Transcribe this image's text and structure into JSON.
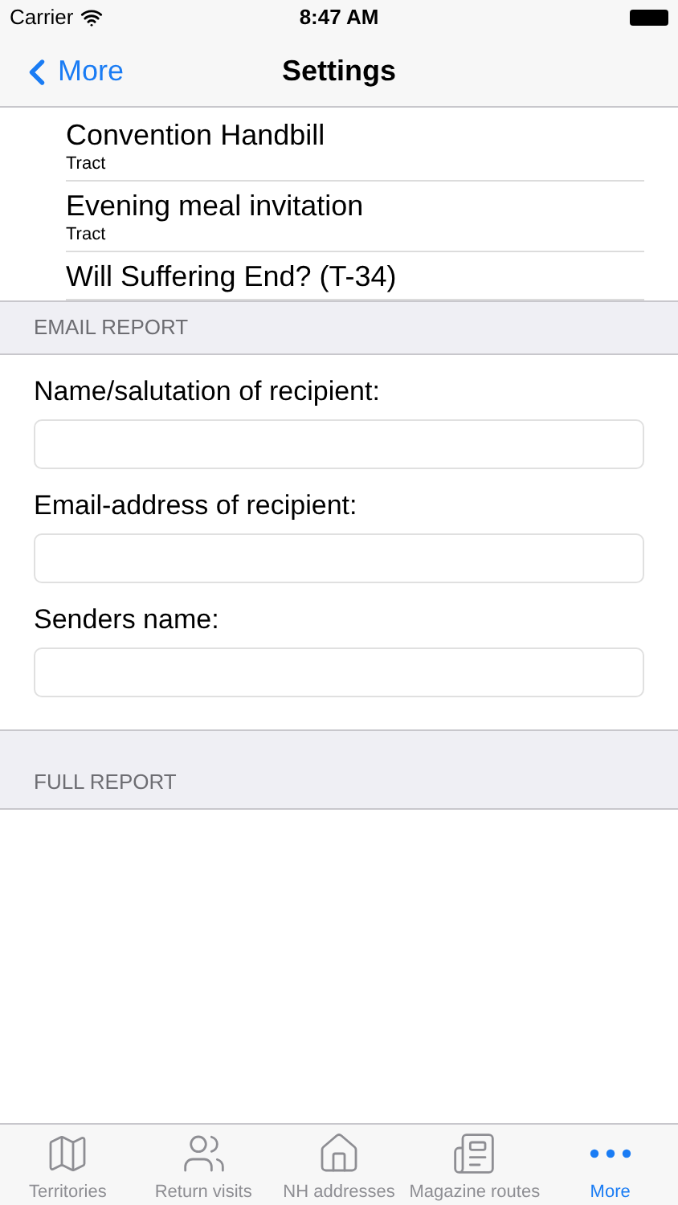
{
  "status_bar": {
    "carrier": "Carrier",
    "time": "8:47 AM"
  },
  "nav": {
    "back": "More",
    "title": "Settings"
  },
  "list": [
    {
      "title": "Convention Handbill",
      "subtitle": "Tract"
    },
    {
      "title": "Evening meal invitation",
      "subtitle": "Tract"
    },
    {
      "title": "Will Suffering End? (T-34)"
    }
  ],
  "email_section": {
    "header": "EMAIL REPORT",
    "fields": [
      {
        "label": "Name/salutation of recipient:"
      },
      {
        "label": "Email-address of recipient:"
      },
      {
        "label": "Senders name:"
      }
    ]
  },
  "full_section": {
    "header": "FULL REPORT"
  },
  "tabs": [
    {
      "kind": "map",
      "label": "Territories",
      "selected": false
    },
    {
      "kind": "people",
      "label": "Return visits",
      "selected": false
    },
    {
      "kind": "house",
      "label": "NH addresses",
      "selected": false
    },
    {
      "kind": "magazine",
      "label": "Magazine routes",
      "selected": false
    },
    {
      "kind": "more",
      "label": "More",
      "selected": true
    }
  ]
}
